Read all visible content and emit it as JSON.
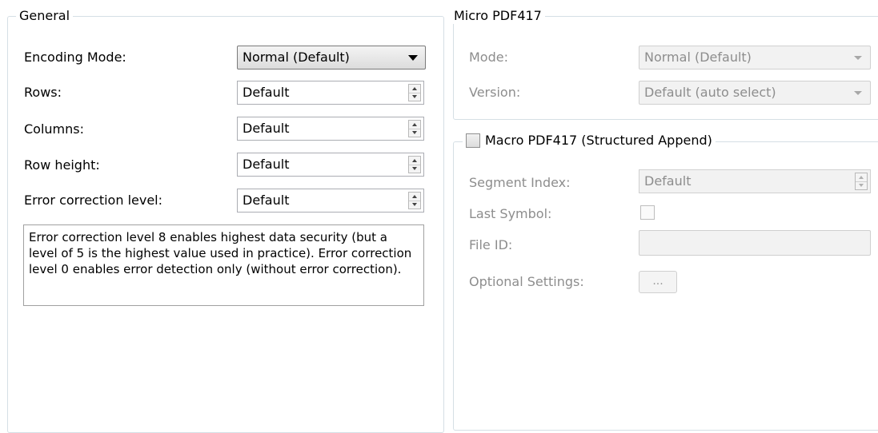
{
  "general": {
    "title": "General",
    "encoding_mode": {
      "label": "Encoding Mode:",
      "value": "Normal (Default)"
    },
    "rows": {
      "label": "Rows:",
      "value": "Default"
    },
    "columns": {
      "label": "Columns:",
      "value": "Default"
    },
    "row_height": {
      "label": "Row height:",
      "value": "Default"
    },
    "error_correction": {
      "label": "Error correction level:",
      "value": "Default"
    },
    "info_text": "Error correction level 8 enables highest data security (but a level of 5 is the highest value used in practice). Error correction level 0 enables error detection only (without error correction)."
  },
  "micro": {
    "title": "Micro PDF417",
    "mode": {
      "label": "Mode:",
      "value": "Normal (Default)"
    },
    "version": {
      "label": "Version:",
      "value": "Default (auto select)"
    }
  },
  "macro": {
    "title": "Macro PDF417 (Structured Append)",
    "checked": false,
    "segment_index": {
      "label": "Segment Index:",
      "value": "Default"
    },
    "last_symbol": {
      "label": "Last Symbol:",
      "checked": false
    },
    "file_id": {
      "label": "File ID:",
      "value": ""
    },
    "optional_settings": {
      "label": "Optional Settings:",
      "button": "..."
    }
  }
}
